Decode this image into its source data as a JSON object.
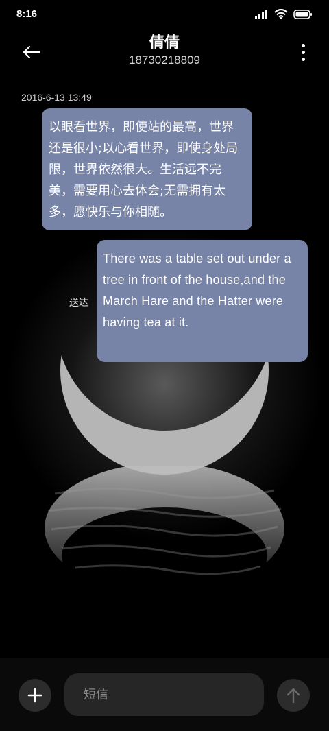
{
  "status_bar": {
    "time": "8:16"
  },
  "header": {
    "contact_name": "倩倩",
    "contact_number": "18730218809"
  },
  "conversation": {
    "timestamp": "2016-6-13 13:49",
    "messages": [
      {
        "direction": "incoming",
        "text": "以眼看世界，即使站的最高，世界还是很小;以心看世界，即使身处局限，世界依然很大。生活远不完美，需要用心去体会;无需拥有太多，愿快乐与你相随。"
      },
      {
        "direction": "outgoing",
        "text": "There was a table set out under a tree in front of the house,and the March Hare and the Hatter were having tea at it.",
        "status": "送达"
      }
    ]
  },
  "composer": {
    "placeholder": "短信",
    "value": ""
  },
  "icons": {
    "back": "back-arrow-icon",
    "more": "more-vertical-icon",
    "add": "plus-icon",
    "send": "send-arrow-icon",
    "signal": "signal-icon",
    "wifi": "wifi-icon",
    "battery": "battery-icon"
  },
  "colors": {
    "bubble": "#7784a8",
    "background": "#000000"
  }
}
